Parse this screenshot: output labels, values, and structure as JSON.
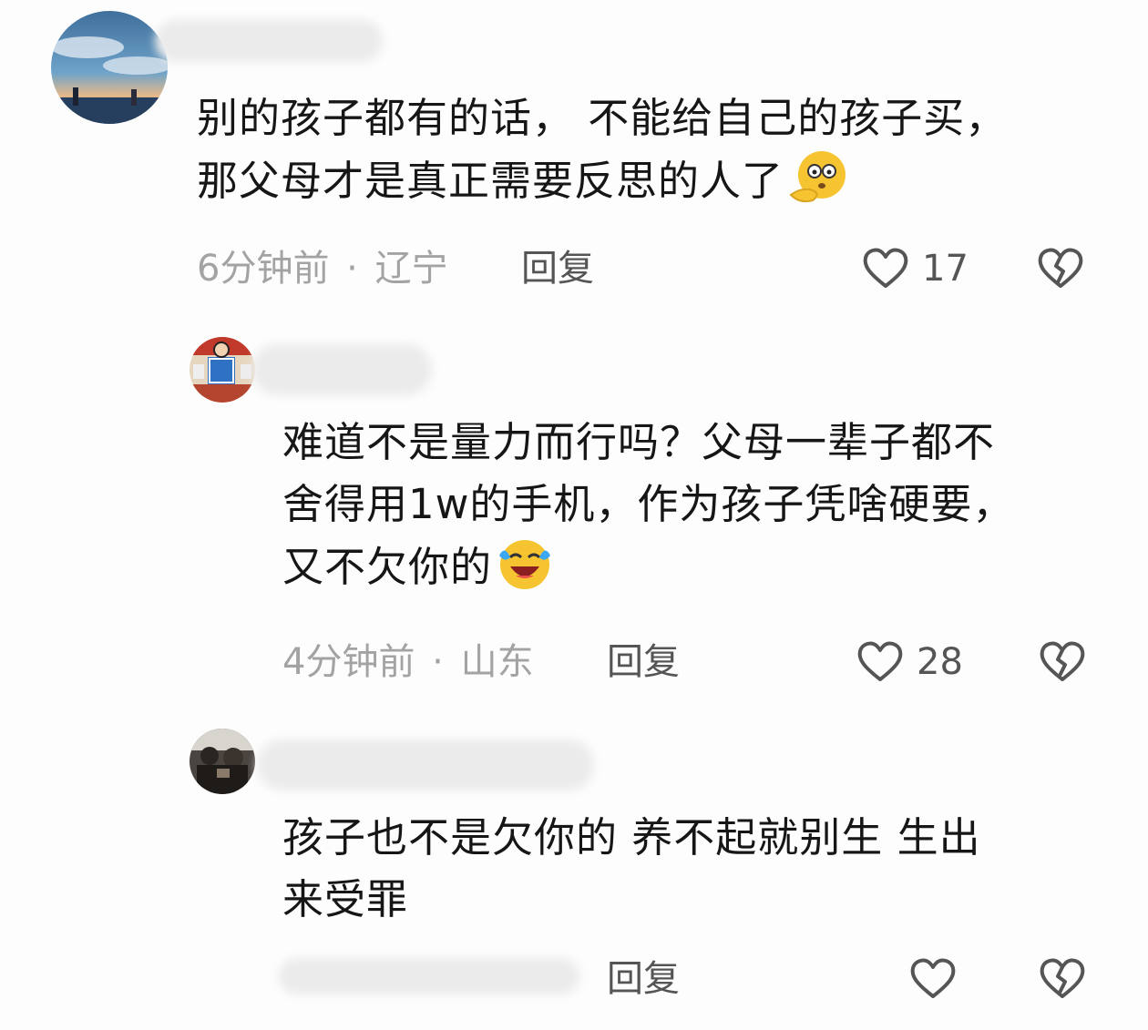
{
  "comments": [
    {
      "text_lines": [
        "别的孩子都有的话， 不能给自己的孩子买，",
        "那父母才是真正需要反思的人了"
      ],
      "emoji": "thinking-face-emoji",
      "time": "6分钟前",
      "separator": "·",
      "location": "辽宁",
      "reply_label": "回复",
      "like_count": "17"
    },
    {
      "text_lines": [
        "难道不是量力而行吗？父母一辈子都不",
        "舍得用1w的手机，作为孩子凭啥硬要，",
        "又不欠你的"
      ],
      "emoji": "crying-laughing-emoji",
      "time": "4分钟前",
      "separator": "·",
      "location": "山东",
      "reply_label": "回复",
      "like_count": "28"
    },
    {
      "text_lines": [
        "孩子也不是欠你的 养不起就别生 生出",
        "来受罪"
      ],
      "reply_label": "回复",
      "like_count": ""
    }
  ],
  "icons": {
    "like": "heart-outline-icon",
    "dislike": "broken-heart-icon"
  },
  "colors": {
    "text": "#161616",
    "meta": "#a3a3a3",
    "action": "#555555",
    "emoji": "#f6c431"
  }
}
